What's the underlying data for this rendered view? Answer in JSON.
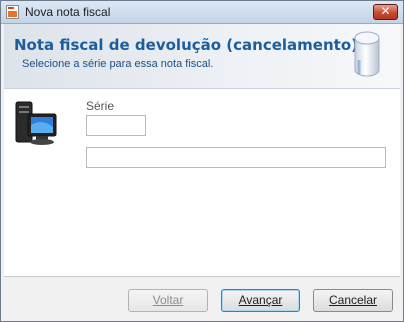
{
  "window": {
    "title": "Nova nota fiscal",
    "close_glyph": "✕"
  },
  "header": {
    "title": "Nota fiscal de devolução (cancelamento)",
    "subtitle": "Selecione a série para essa nota fiscal."
  },
  "form": {
    "serie_label": "Série",
    "serie_value": "",
    "description_value": ""
  },
  "buttons": {
    "back_label": "Voltar",
    "next_label": "Avançar",
    "cancel_label": "Cancelar"
  },
  "icons": {
    "app": "app-document-icon",
    "header": "database-cylinder-icon",
    "content": "computer-icon"
  },
  "colors": {
    "header_title": "#1c5d9e",
    "close_button": "#c64a33"
  }
}
